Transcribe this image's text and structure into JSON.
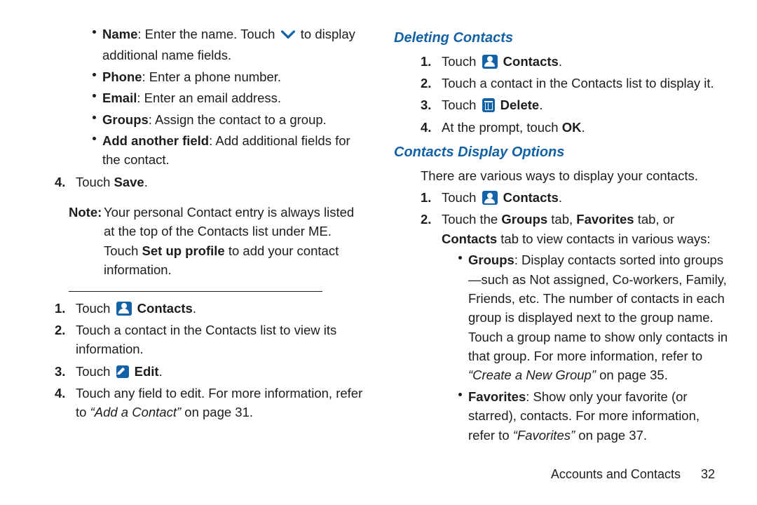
{
  "left": {
    "bullets": [
      {
        "term": "Name",
        "text": ": Enter the name. Touch",
        "tail": " to display additional name fields.",
        "chevron": true
      },
      {
        "term": "Phone",
        "text": ": Enter a phone number."
      },
      {
        "term": "Email",
        "text": ": Enter an email address."
      },
      {
        "term": "Groups",
        "text": ": Assign the contact to a group."
      },
      {
        "term": "Add another field",
        "text": ": Add additional fields for the contact."
      }
    ],
    "step4_pre": "Touch ",
    "step4_btn": "Save",
    "step4_post": ".",
    "note_label": "Note:",
    "note_a": "Your personal Contact entry is always listed at the top of the Contacts list under ME. Touch ",
    "note_b": "Set up profile",
    "note_c": " to add your contact information.",
    "s2": [
      {
        "n": "1.",
        "pre": "Touch ",
        "icon": "person",
        "btn": "Contacts",
        "post": "."
      },
      {
        "n": "2.",
        "pre": "Touch a contact in the Contacts list to view its information."
      },
      {
        "n": "3.",
        "pre": "Touch ",
        "icon": "pencil",
        "btn": "Edit",
        "post": "."
      },
      {
        "n": "4.",
        "pre": "Touch any field to edit. For more information, refer to ",
        "ital": "“Add a Contact”",
        "post": " on page 31."
      }
    ]
  },
  "right": {
    "h_del": "Deleting Contacts",
    "del": [
      {
        "n": "1.",
        "pre": "Touch ",
        "icon": "person",
        "btn": "Contacts",
        "post": "."
      },
      {
        "n": "2.",
        "pre": "Touch a contact in the Contacts list to display it."
      },
      {
        "n": "3.",
        "pre": "Touch ",
        "icon": "trash",
        "btn": "Delete",
        "post": "."
      },
      {
        "n": "4.",
        "pre": "At the prompt, touch ",
        "btn": "OK",
        "post": "."
      }
    ],
    "h_disp": "Contacts Display Options",
    "disp_intro": "There are various ways to display your contacts.",
    "disp": [
      {
        "n": "1.",
        "pre": "Touch ",
        "icon": "person",
        "btn": "Contacts",
        "post": "."
      },
      {
        "n": "2.",
        "pre": "Touch the ",
        "b1": "Groups",
        "mid1": " tab, ",
        "b2": "Favorites",
        "mid2": " tab, or ",
        "b3": "Contacts",
        "post": " tab to view contacts in various ways:",
        "subs": [
          {
            "term": "Groups",
            "text": ": Display contacts sorted into groups—such as Not assigned, Co-workers, Family, Friends, etc. The number of contacts in each group is displayed next to the group name. Touch a group name to show only contacts in that group. For more information, refer to ",
            "ital": "“Create a New Group”",
            "tail": " on page 35."
          },
          {
            "term": "Favorites",
            "text": ": Show only your favorite (or starred), contacts. For more information, refer to ",
            "ital": "“Favorites”",
            "tail": " on page 37."
          }
        ]
      }
    ]
  },
  "footer": {
    "section": "Accounts and Contacts",
    "page": "32"
  }
}
